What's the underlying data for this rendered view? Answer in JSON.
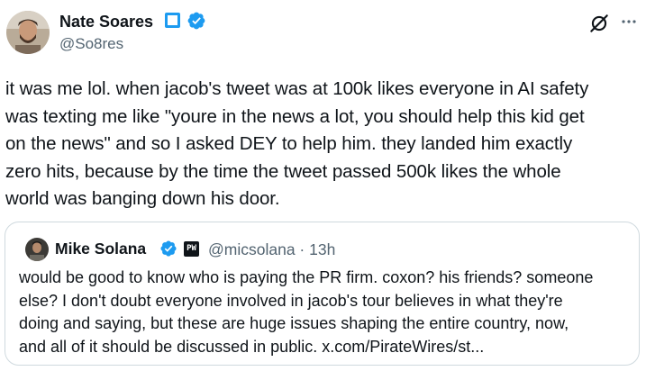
{
  "author": {
    "name": "Nate Soares",
    "handle": "@So8res"
  },
  "tweet": {
    "text": "it was me lol. when jacob's tweet was at 100k likes everyone in AI safety\nwas texting me like \"youre in the news a lot, you should help this kid get\non the news\" and so I asked DEY to help him. they landed him exactly\nzero hits, because by the time the tweet passed 500k likes the whole\nworld was banging down his door."
  },
  "quote": {
    "name": "Mike Solana",
    "affiliation_badge": "PW",
    "handle_time": "@micsolana · 13h",
    "text": "would be good to know who is paying the PR firm. coxon? his friends? someone\nelse? I don't doubt everyone involved in jacob's tour believes in what they're\ndoing and saying, but these are huge issues shaping the entire country, now,\nand all of it should be discussed in public. x.com/PirateWires/st..."
  },
  "icons": {
    "verified": "verified-badge-icon",
    "grok": "grok-icon",
    "more": "more-options-icon"
  },
  "colors": {
    "accent": "#1d9bf0",
    "text": "#0f1419",
    "secondary": "#536471",
    "border": "#cfd9de"
  }
}
